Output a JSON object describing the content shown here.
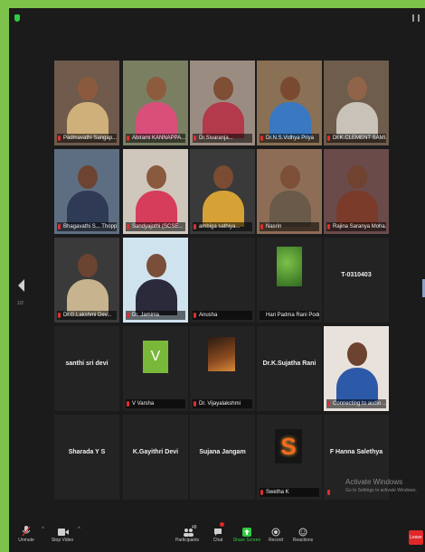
{
  "grid": {
    "rows": [
      [
        {
          "name": "Padmavathi Sangap...",
          "type": "video",
          "muted": true,
          "bg": "#6f5a4c",
          "skin": "#8b5a3c",
          "cloth": "#d0b07a"
        },
        {
          "name": "Abirami KANNAPPA...",
          "type": "video",
          "muted": true,
          "bg": "#7a7f62",
          "skin": "#8d5b3e",
          "cloth": "#d94f7a"
        },
        {
          "name": "Dr.Sivaranja...",
          "type": "video",
          "muted": true,
          "bg": "#9b8c82",
          "skin": "#7e4e35",
          "cloth": "#b23a4a"
        },
        {
          "name": "Dr.N.S.Vidhya Priya",
          "type": "video",
          "muted": true,
          "bg": "#8a7054",
          "skin": "#7a4a30",
          "cloth": "#3a78c2"
        },
        {
          "name": "Dr.K.CLEMENT SAMUEL",
          "type": "video",
          "muted": true,
          "bg": "#6e5c4c",
          "skin": "#8f6448",
          "cloth": "#c9c2b8"
        }
      ],
      [
        {
          "name": "Bhagavathi S... Thoppat...",
          "type": "video",
          "muted": true,
          "active": true,
          "bg": "#5e6e82",
          "skin": "#6c4431",
          "cloth": "#2f3b55"
        },
        {
          "name": "Sandyajothi (SCSE...",
          "type": "video",
          "muted": true,
          "bg": "#cfc6bc",
          "skin": "#8a5a3e",
          "cloth": "#d63d5a"
        },
        {
          "name": "ambiga sathiya...",
          "type": "video",
          "muted": true,
          "bg": "#3a3a3a",
          "skin": "#7b4b33",
          "cloth": "#d6a235"
        },
        {
          "name": "Nasrin",
          "type": "video",
          "muted": true,
          "bg": "#8d6d56",
          "skin": "#7d5037",
          "cloth": "#6a5a4a"
        },
        {
          "name": "Rajina Saranya Moha...",
          "type": "video",
          "muted": true,
          "bg": "#6b4a4a",
          "skin": "#6f4330",
          "cloth": "#7a3b2a"
        }
      ],
      [
        {
          "name": "Dr.G.Lakshmi Dev...",
          "type": "video",
          "muted": true,
          "bg": "#3a3a3a",
          "skin": "#6a4331",
          "cloth": "#c7b48e"
        },
        {
          "name": "Dr. Jaminia",
          "type": "video",
          "muted": true,
          "bg": "#cfe3ef",
          "skin": "#7a4f39",
          "cloth": "#2a2a3a"
        },
        {
          "name": "Anusha",
          "type": "name",
          "muted": true,
          "label": ""
        },
        {
          "name": "Hari Padma Rani Poddi",
          "type": "leaf",
          "muted": false
        },
        {
          "name": "",
          "type": "name",
          "muted": false,
          "label": "T-0310403"
        }
      ],
      [
        {
          "name": "",
          "type": "name",
          "muted": false,
          "label": "santhi sri devi"
        },
        {
          "name": "V Varsha",
          "type": "v",
          "muted": true,
          "letter": "V"
        },
        {
          "name": "Dr. Vijayalakshmi",
          "type": "art",
          "muted": true
        },
        {
          "name": "",
          "type": "name",
          "muted": false,
          "label": "Dr.K.Sujatha Rani"
        },
        {
          "name": "Connecting to audio ...",
          "type": "video",
          "muted": true,
          "bg": "#e9e2dc",
          "skin": "#6b4330",
          "cloth": "#2d5aa8"
        }
      ],
      [
        {
          "name": "",
          "type": "name",
          "muted": false,
          "label": "Sharada Y S"
        },
        {
          "name": "",
          "type": "name",
          "muted": false,
          "label": "K.Gayithri Devi"
        },
        {
          "name": "",
          "type": "name",
          "muted": false,
          "label": "Sujana Jangam"
        },
        {
          "name": "Swetha K",
          "type": "s",
          "muted": true,
          "letter": "S"
        },
        {
          "name": "",
          "type": "name",
          "muted": true,
          "label": "F Hanna Salethya"
        }
      ]
    ]
  },
  "side": {
    "page_label": "1/2"
  },
  "watermark": {
    "line1": "Activate Windows",
    "line2": "Go to Settings to activate Windows."
  },
  "toolbar": {
    "unmute": "Unmute",
    "stop_video": "Stop Video",
    "participants": "Participants",
    "participants_count": "48",
    "chat": "Chat",
    "share_screen": "Share Screen",
    "record": "Record",
    "reactions": "Reactions",
    "end": "Leave"
  },
  "colors": {
    "background": "#7dc24a",
    "share_green": "#2ecc40",
    "end_red": "#e02828",
    "muted_red": "#e02f2f"
  }
}
